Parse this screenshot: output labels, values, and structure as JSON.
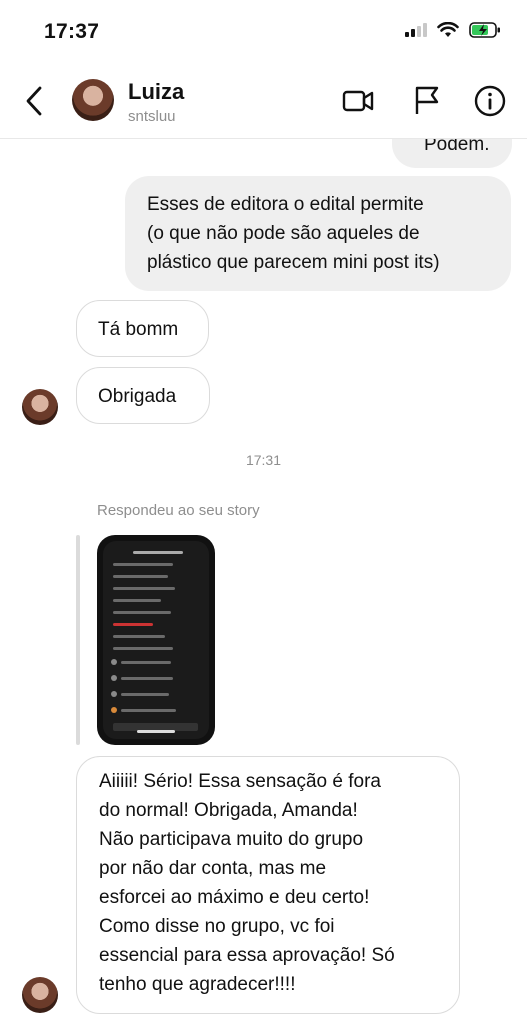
{
  "status_bar": {
    "time": "17:37"
  },
  "header": {
    "name": "Luiza",
    "handle": "sntsluu"
  },
  "messages": {
    "cut_top": "Podem.",
    "outgoing_1": [
      "Esses de editora o edital permite",
      "(o que não pode são aqueles de",
      "plástico que parecem mini post its)"
    ],
    "incoming_1": "Tá bomm",
    "incoming_2": "Obrigada",
    "timestamp": "17:31",
    "replied_label": "Respondeu ao seu story",
    "incoming_3": [
      "Aiiiii! Sério! Essa sensação é fora",
      "do normal! Obrigada, Amanda!",
      "Não participava muito do grupo",
      "por não dar conta, mas me",
      "esforcei ao máximo e deu certo!",
      "Como disse no grupo, vc foi",
      "essencial para essa aprovação! Só",
      "tenho que agradecer!!!!"
    ]
  }
}
